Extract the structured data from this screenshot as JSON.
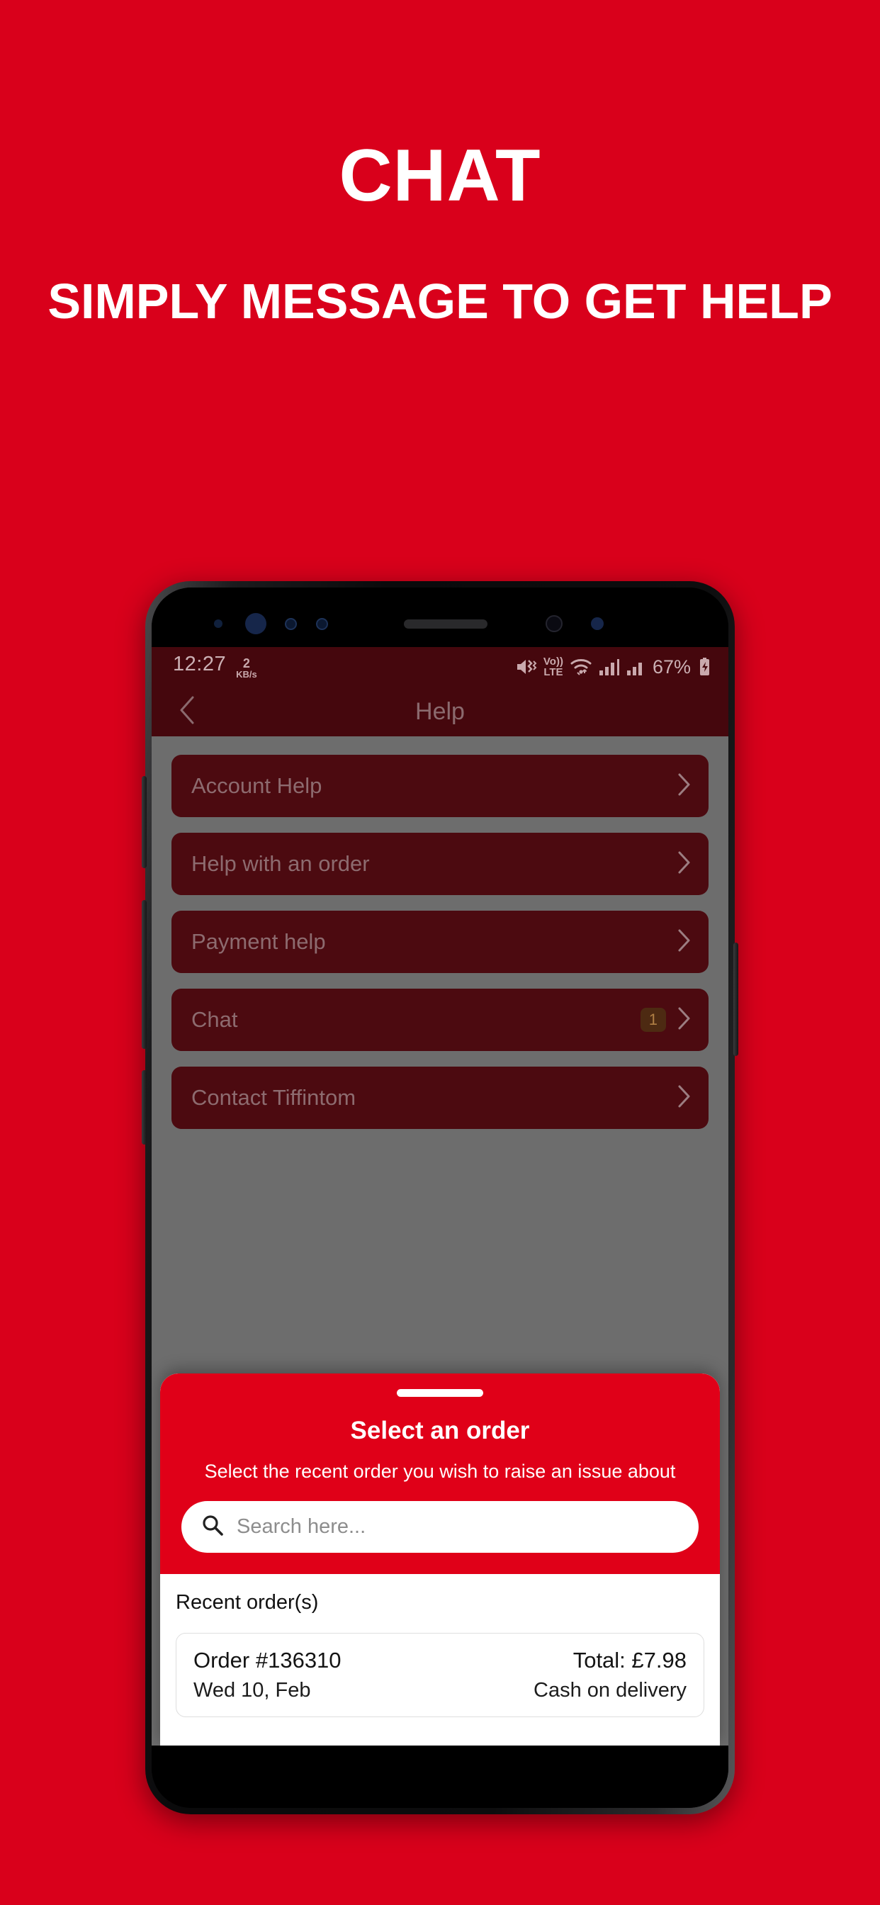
{
  "promo": {
    "title": "CHAT",
    "subtitle": "SIMPLY MESSAGE TO GET HELP",
    "background_color": "#D9001B"
  },
  "phone": {
    "statusbar": {
      "time": "12:27",
      "data_rate_value": "2",
      "data_rate_unit": "KB/s",
      "mute_icon": "volume-mute-icon",
      "volte_top": "Vo))",
      "volte_bottom": "LTE",
      "wifi_icon": "wifi-icon",
      "signal_one_icon": "signal-bars-icon",
      "signal_two_icon": "signal-bars-icon",
      "battery_percent": "67%",
      "battery_icon": "battery-charging-icon"
    },
    "appbar": {
      "back_icon": "chevron-left-icon",
      "title": "Help"
    },
    "menu": {
      "items": [
        {
          "label": "Account Help",
          "badge": "",
          "chevron": "chevron-right-icon"
        },
        {
          "label": "Help with an order",
          "badge": "",
          "chevron": "chevron-right-icon"
        },
        {
          "label": "Payment help",
          "badge": "",
          "chevron": "chevron-right-icon"
        },
        {
          "label": "Chat",
          "badge": "1",
          "chevron": "chevron-right-icon"
        },
        {
          "label": "Contact Tiffintom",
          "badge": "",
          "chevron": "chevron-right-icon"
        }
      ]
    },
    "sheet": {
      "title": "Select an order",
      "subtitle": "Select the recent order you wish to raise an issue about",
      "search_placeholder": "Search here...",
      "search_value": "",
      "search_icon": "search-icon",
      "recent_label": "Recent order(s)",
      "orders": [
        {
          "order_number": "Order #136310",
          "date": "Wed 10, Feb",
          "total": "Total: £7.98",
          "payment": "Cash on delivery"
        }
      ]
    },
    "colors": {
      "brand_red": "#E00018",
      "app_dark_red": "#45070d",
      "tile_red": "#4c0a10",
      "screen_gray": "#6d6d6d"
    }
  }
}
